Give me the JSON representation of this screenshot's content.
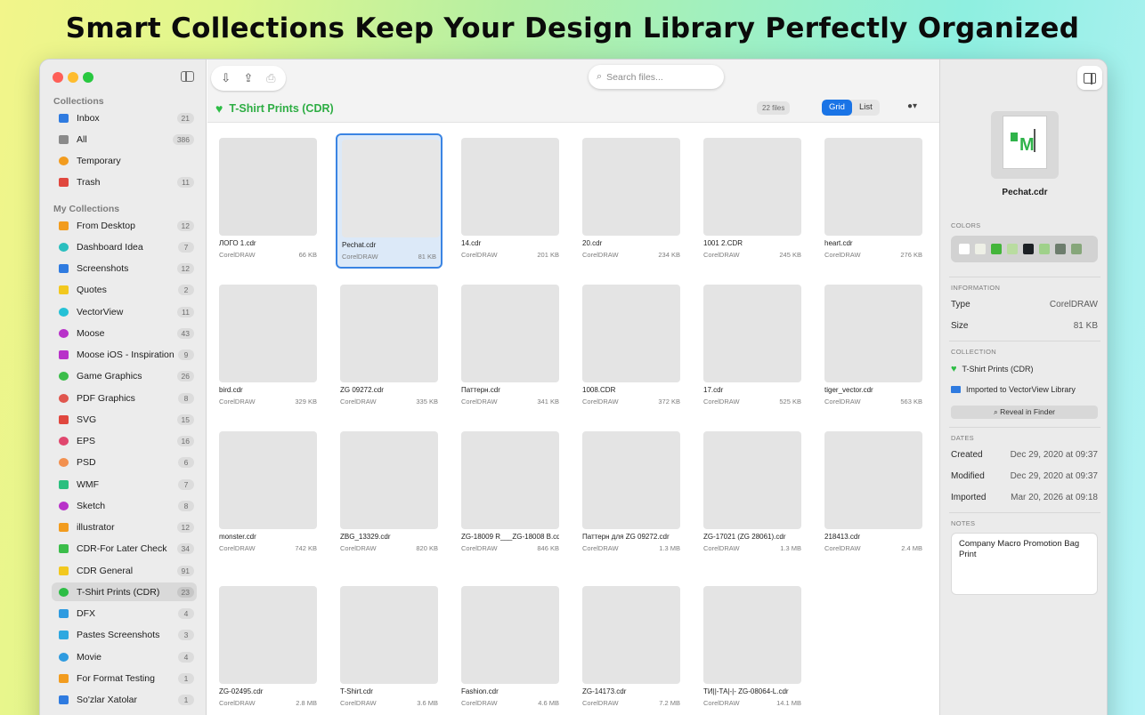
{
  "headline": "Smart Collections Keep Your Design Library Perfectly Organized",
  "sidebar": {
    "collections_title": "Collections",
    "collections": [
      {
        "label": "Inbox",
        "count": "21",
        "icon": "inbox-icon",
        "color": "#2f7be0"
      },
      {
        "label": "All",
        "count": "386",
        "icon": "archive-icon",
        "color": "#8a8a8a"
      },
      {
        "label": "Temporary",
        "count": "",
        "icon": "clock-icon",
        "color": "#f29c1f"
      },
      {
        "label": "Trash",
        "count": "11",
        "icon": "trash-icon",
        "color": "#e0473e"
      }
    ],
    "my_collections_title": "My Collections",
    "my_collections": [
      {
        "label": "From Desktop",
        "count": "12",
        "icon": "folder-icon",
        "color": "#f29c1f"
      },
      {
        "label": "Dashboard Idea",
        "count": "7",
        "icon": "star-icon",
        "color": "#2bbfbf"
      },
      {
        "label": "Screenshots",
        "count": "12",
        "icon": "bookmark-icon",
        "color": "#2f7be0"
      },
      {
        "label": "Quotes",
        "count": "2",
        "icon": "bookmark-icon",
        "color": "#f2c81f"
      },
      {
        "label": "VectorView",
        "count": "11",
        "icon": "heart-icon",
        "color": "#25c1d6"
      },
      {
        "label": "Moose",
        "count": "43",
        "icon": "heart-icon",
        "color": "#b832c9"
      },
      {
        "label": "Moose iOS - Inspiration",
        "count": "9",
        "icon": "bookmark-icon",
        "color": "#b832c9"
      },
      {
        "label": "Game Graphics",
        "count": "26",
        "icon": "link-icon",
        "color": "#3bbd4a"
      },
      {
        "label": "PDF Graphics",
        "count": "8",
        "icon": "link-icon",
        "color": "#e0564e"
      },
      {
        "label": "SVG",
        "count": "15",
        "icon": "smart-folder-icon",
        "color": "#e0473e"
      },
      {
        "label": "EPS",
        "count": "16",
        "icon": "star-icon",
        "color": "#e0476e"
      },
      {
        "label": "PSD",
        "count": "6",
        "icon": "tag-icon",
        "color": "#f2904f"
      },
      {
        "label": "WMF",
        "count": "7",
        "icon": "smart-folder-icon",
        "color": "#2bbf7f"
      },
      {
        "label": "Sketch",
        "count": "8",
        "icon": "heart-icon",
        "color": "#b832c9"
      },
      {
        "label": "illustrator",
        "count": "12",
        "icon": "folder-icon",
        "color": "#f29c1f"
      },
      {
        "label": "CDR-For Later Check",
        "count": "34",
        "icon": "smart-folder-icon",
        "color": "#3bbd4a"
      },
      {
        "label": "CDR General",
        "count": "91",
        "icon": "folder-icon",
        "color": "#f2c81f"
      },
      {
        "label": "T-Shirt Prints (CDR)",
        "count": "23",
        "icon": "heart-icon",
        "color": "#2dbd45"
      },
      {
        "label": "DFX",
        "count": "4",
        "icon": "smart-folder-icon",
        "color": "#2f9be0"
      },
      {
        "label": "Pastes Screenshots",
        "count": "3",
        "icon": "folder-icon",
        "color": "#2fa8e0"
      },
      {
        "label": "Movie",
        "count": "4",
        "icon": "link-icon",
        "color": "#2f9be0"
      },
      {
        "label": "For Format Testing",
        "count": "1",
        "icon": "folder-icon",
        "color": "#f29c1f"
      },
      {
        "label": "So'zlar Xatolar",
        "count": "1",
        "icon": "bookmark-icon",
        "color": "#2f7be0"
      }
    ]
  },
  "toolbar": {
    "import_icon": "import-icon",
    "share_icon": "share-icon",
    "print_icon": "print-icon",
    "search_placeholder": "Search files...",
    "collection_title": "T-Shirt Prints (CDR)",
    "file_count": "22 files",
    "view_grid": "Grid",
    "view_list": "List",
    "sort_icon": "sort-menu-icon"
  },
  "files": [
    {
      "name": "ЛОГО  1.cdr",
      "type": "CorelDRAW",
      "size": "66 KB",
      "thumb": "#e2e2e2"
    },
    {
      "name": "Pechat.cdr",
      "type": "CorelDRAW",
      "size": "81 KB",
      "thumb": "#e6e6e6",
      "selected": true
    },
    {
      "name": "14.cdr",
      "type": "CorelDRAW",
      "size": "201 KB",
      "thumb": "#e4e4e4"
    },
    {
      "name": "20.cdr",
      "type": "CorelDRAW",
      "size": "234 KB",
      "thumb": "#e4e4e4"
    },
    {
      "name": "1001 2.CDR",
      "type": "CorelDRAW",
      "size": "245 KB",
      "thumb": "#e4e4e4"
    },
    {
      "name": "heart.cdr",
      "type": "CorelDRAW",
      "size": "276 KB",
      "thumb": "#e4e4e4"
    },
    {
      "name": "bird.cdr",
      "type": "CorelDRAW",
      "size": "329 KB",
      "thumb": "#e4e4e4"
    },
    {
      "name": "ZG 09272.cdr",
      "type": "CorelDRAW",
      "size": "335 KB",
      "thumb": "#e4e4e4"
    },
    {
      "name": "Паттерн.cdr",
      "type": "CorelDRAW",
      "size": "341 KB",
      "thumb": "#e4e4e4"
    },
    {
      "name": "1008.CDR",
      "type": "CorelDRAW",
      "size": "372 KB",
      "thumb": "#e4e4e4"
    },
    {
      "name": "17.cdr",
      "type": "CorelDRAW",
      "size": "525 KB",
      "thumb": "#e4e4e4"
    },
    {
      "name": "tiger_vector.cdr",
      "type": "CorelDRAW",
      "size": "563 KB",
      "thumb": "#e4e4e4"
    },
    {
      "name": "monster.cdr",
      "type": "CorelDRAW",
      "size": "742 KB",
      "thumb": "#e4e4e4"
    },
    {
      "name": "ZBG_13329.cdr",
      "type": "CorelDRAW",
      "size": "820 KB",
      "thumb": "#e4e4e4"
    },
    {
      "name": "ZG-18009 R___ZG-18008 B.cdr",
      "type": "CorelDRAW",
      "size": "846 KB",
      "thumb": "#e4e4e4"
    },
    {
      "name": "Паттерн для ZG 09272.cdr",
      "type": "CorelDRAW",
      "size": "1.3 MB",
      "thumb": "#e4e4e4"
    },
    {
      "name": "ZG-17021 (ZG 28061).cdr",
      "type": "CorelDRAW",
      "size": "1.3 MB",
      "thumb": "#e4e4e4"
    },
    {
      "name": "218413.cdr",
      "type": "CorelDRAW",
      "size": "2.4 MB",
      "thumb": "#e4e4e4"
    },
    {
      "name": "ZG-02495.cdr",
      "type": "CorelDRAW",
      "size": "2.8 MB",
      "thumb": "#e4e4e4"
    },
    {
      "name": "T-Shirt.cdr",
      "type": "CorelDRAW",
      "size": "3.6 MB",
      "thumb": "#e4e4e4"
    },
    {
      "name": "Fashion.cdr",
      "type": "CorelDRAW",
      "size": "4.6 MB",
      "thumb": "#e4e4e4"
    },
    {
      "name": "ZG-14173.cdr",
      "type": "CorelDRAW",
      "size": "7.2 MB",
      "thumb": "#e4e4e4"
    },
    {
      "name": "ТИ||-ТА|-|- ZG-08064-L.cdr",
      "type": "CorelDRAW",
      "size": "14.1 MB",
      "thumb": "#e4e4e4"
    }
  ],
  "inspector": {
    "file_name": "Pechat.cdr",
    "colors_label": "COLORS",
    "colors": [
      "#ffffff",
      "#eef0e6",
      "#43b53a",
      "#b9dca0",
      "#1c2024",
      "#9fd18a",
      "#6d7d6d",
      "#86a67a"
    ],
    "information_label": "INFORMATION",
    "type_key": "Type",
    "type_value": "CorelDRAW",
    "size_key": "Size",
    "size_value": "81 KB",
    "collection_label": "COLLECTION",
    "collection_name": "T-Shirt Prints (CDR)",
    "imported_to": "Imported to VectorView Library",
    "reveal_button": "Reveal in Finder",
    "dates_label": "DATES",
    "created_key": "Created",
    "created_value": "Dec 29, 2020 at 09:37",
    "modified_key": "Modified",
    "modified_value": "Dec 29, 2020 at 09:37",
    "imported_key": "Imported",
    "imported_value": "Mar 20, 2026 at 09:18",
    "notes_label": "NOTES",
    "notes_text": "Company Macro Promotion Bag Print"
  }
}
